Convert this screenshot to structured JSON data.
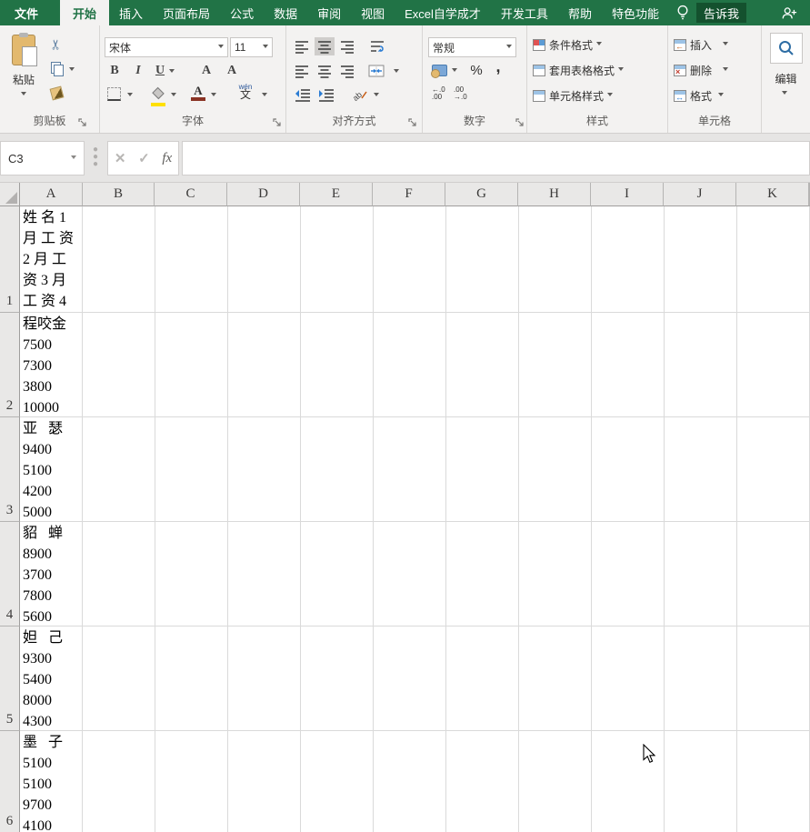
{
  "tabs": {
    "items": [
      "文件",
      "开始",
      "插入",
      "页面布局",
      "公式",
      "数据",
      "审阅",
      "视图",
      "Excel自学成才",
      "开发工具",
      "帮助",
      "特色功能",
      "告诉我"
    ]
  },
  "ribbon": {
    "clipboard": {
      "label": "剪贴板",
      "paste": "粘贴"
    },
    "font": {
      "label": "字体",
      "font_name": "宋体",
      "font_size": "11",
      "bold": "B",
      "italic": "I",
      "underline": "U",
      "grow": "A",
      "shrink": "A",
      "font_color_letter": "A",
      "phonetic_pinyin": "wén",
      "phonetic_hanzi": "文"
    },
    "alignment": {
      "label": "对齐方式"
    },
    "number": {
      "label": "数字",
      "format": "常规",
      "percent": "%",
      "comma": ",",
      "inc_decimal": "←.0\n.00",
      "dec_decimal": ".00\n→.0"
    },
    "styles": {
      "label": "样式",
      "items": [
        "条件格式",
        "套用表格格式",
        "单元格样式"
      ]
    },
    "cells": {
      "label": "单元格",
      "items": [
        "插入",
        "删除",
        "格式"
      ]
    },
    "editing": {
      "label": "编辑"
    }
  },
  "formula_bar": {
    "name_box": "C3",
    "cancel": "✕",
    "enter": "✓",
    "fx": "fx",
    "value": ""
  },
  "grid": {
    "columns": [
      "A",
      "B",
      "C",
      "D",
      "E",
      "F",
      "G",
      "H",
      "I",
      "J",
      "K"
    ],
    "rows": [
      {
        "num": "1",
        "a_lines": [
          "姓 名 1",
          "月 工 资",
          "2 月 工",
          "资 3 月",
          "工 资 4"
        ]
      },
      {
        "num": "2",
        "a_lines": [
          "程咬金",
          "7500",
          "7300",
          "3800",
          "10000"
        ]
      },
      {
        "num": "3",
        "a_lines": [
          "亚   瑟",
          "9400",
          "5100",
          "4200",
          "5000"
        ]
      },
      {
        "num": "4",
        "a_lines": [
          "貂   蝉",
          "8900",
          "3700",
          "7800",
          "5600"
        ]
      },
      {
        "num": "5",
        "a_lines": [
          "妲   己",
          "9300",
          "5400",
          "8000",
          "4300"
        ]
      },
      {
        "num": "6",
        "a_lines": [
          "墨   子",
          "5100",
          "5100",
          "9700",
          "4100"
        ]
      }
    ]
  },
  "colors": {
    "accent_green": "#217346",
    "tellme_bg": "#14512e",
    "fill_yellow": "#ffe000",
    "font_color_red": "#8a3324"
  }
}
